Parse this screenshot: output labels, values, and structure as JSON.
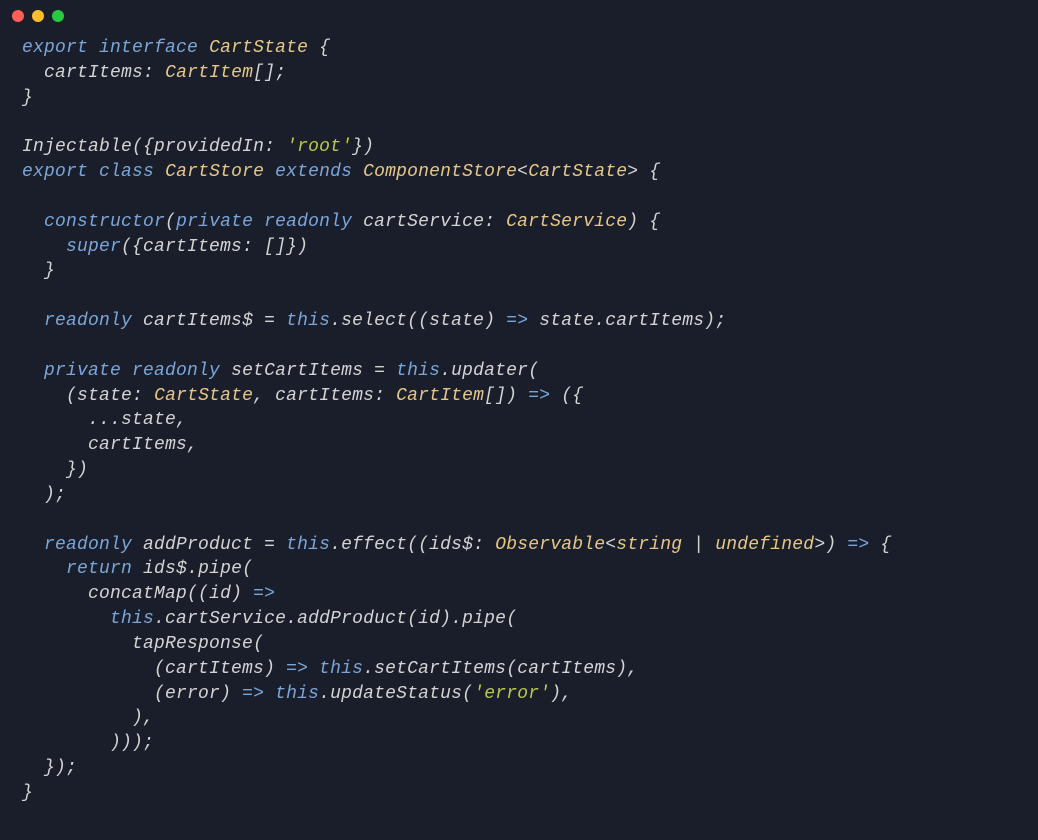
{
  "titleBar": {
    "buttons": [
      "close",
      "minimize",
      "maximize"
    ]
  },
  "code": {
    "tokens": [
      [
        {
          "t": "kw",
          "v": "export"
        },
        {
          "t": "sp",
          "v": " "
        },
        {
          "t": "kw",
          "v": "interface"
        },
        {
          "t": "sp",
          "v": " "
        },
        {
          "t": "type",
          "v": "CartState"
        },
        {
          "t": "sp",
          "v": " "
        },
        {
          "t": "punc",
          "v": "{"
        }
      ],
      [
        {
          "t": "sp",
          "v": "  "
        },
        {
          "t": "prop",
          "v": "cartItems"
        },
        {
          "t": "punc",
          "v": ": "
        },
        {
          "t": "type",
          "v": "CartItem"
        },
        {
          "t": "punc",
          "v": "[];"
        }
      ],
      [
        {
          "t": "punc",
          "v": "}"
        }
      ],
      [],
      [
        {
          "t": "decor",
          "v": "Injectable"
        },
        {
          "t": "punc",
          "v": "({"
        },
        {
          "t": "prop",
          "v": "providedIn"
        },
        {
          "t": "punc",
          "v": ": "
        },
        {
          "t": "str",
          "v": "'root'"
        },
        {
          "t": "punc",
          "v": "})"
        }
      ],
      [
        {
          "t": "kw",
          "v": "export"
        },
        {
          "t": "sp",
          "v": " "
        },
        {
          "t": "kw",
          "v": "class"
        },
        {
          "t": "sp",
          "v": " "
        },
        {
          "t": "type",
          "v": "CartStore"
        },
        {
          "t": "sp",
          "v": " "
        },
        {
          "t": "kw",
          "v": "extends"
        },
        {
          "t": "sp",
          "v": " "
        },
        {
          "t": "type",
          "v": "ComponentStore"
        },
        {
          "t": "punc",
          "v": "<"
        },
        {
          "t": "type",
          "v": "CartState"
        },
        {
          "t": "punc",
          "v": "> {"
        }
      ],
      [],
      [
        {
          "t": "sp",
          "v": "  "
        },
        {
          "t": "kw",
          "v": "constructor"
        },
        {
          "t": "punc",
          "v": "("
        },
        {
          "t": "kw",
          "v": "private"
        },
        {
          "t": "sp",
          "v": " "
        },
        {
          "t": "kw",
          "v": "readonly"
        },
        {
          "t": "sp",
          "v": " "
        },
        {
          "t": "param",
          "v": "cartService"
        },
        {
          "t": "punc",
          "v": ": "
        },
        {
          "t": "type",
          "v": "CartService"
        },
        {
          "t": "punc",
          "v": ") {"
        }
      ],
      [
        {
          "t": "sp",
          "v": "    "
        },
        {
          "t": "kw",
          "v": "super"
        },
        {
          "t": "punc",
          "v": "({"
        },
        {
          "t": "prop",
          "v": "cartItems"
        },
        {
          "t": "punc",
          "v": ": []})"
        }
      ],
      [
        {
          "t": "sp",
          "v": "  "
        },
        {
          "t": "punc",
          "v": "}"
        }
      ],
      [],
      [
        {
          "t": "sp",
          "v": "  "
        },
        {
          "t": "kw",
          "v": "readonly"
        },
        {
          "t": "sp",
          "v": " "
        },
        {
          "t": "prop",
          "v": "cartItems$"
        },
        {
          "t": "sp",
          "v": " "
        },
        {
          "t": "punc",
          "v": "= "
        },
        {
          "t": "this",
          "v": "this"
        },
        {
          "t": "punc",
          "v": "."
        },
        {
          "t": "method",
          "v": "select"
        },
        {
          "t": "punc",
          "v": "(("
        },
        {
          "t": "param",
          "v": "state"
        },
        {
          "t": "punc",
          "v": ") "
        },
        {
          "t": "kw",
          "v": "=>"
        },
        {
          "t": "sp",
          "v": " "
        },
        {
          "t": "var",
          "v": "state"
        },
        {
          "t": "punc",
          "v": "."
        },
        {
          "t": "prop",
          "v": "cartItems"
        },
        {
          "t": "punc",
          "v": ");"
        }
      ],
      [],
      [
        {
          "t": "sp",
          "v": "  "
        },
        {
          "t": "kw",
          "v": "private"
        },
        {
          "t": "sp",
          "v": " "
        },
        {
          "t": "kw",
          "v": "readonly"
        },
        {
          "t": "sp",
          "v": " "
        },
        {
          "t": "prop",
          "v": "setCartItems"
        },
        {
          "t": "sp",
          "v": " "
        },
        {
          "t": "punc",
          "v": "= "
        },
        {
          "t": "this",
          "v": "this"
        },
        {
          "t": "punc",
          "v": "."
        },
        {
          "t": "method",
          "v": "updater"
        },
        {
          "t": "punc",
          "v": "("
        }
      ],
      [
        {
          "t": "sp",
          "v": "    "
        },
        {
          "t": "punc",
          "v": "("
        },
        {
          "t": "param",
          "v": "state"
        },
        {
          "t": "punc",
          "v": ": "
        },
        {
          "t": "type",
          "v": "CartState"
        },
        {
          "t": "punc",
          "v": ", "
        },
        {
          "t": "param",
          "v": "cartItems"
        },
        {
          "t": "punc",
          "v": ": "
        },
        {
          "t": "type",
          "v": "CartItem"
        },
        {
          "t": "punc",
          "v": "[]) "
        },
        {
          "t": "kw",
          "v": "=>"
        },
        {
          "t": "sp",
          "v": " "
        },
        {
          "t": "punc",
          "v": "({"
        }
      ],
      [
        {
          "t": "sp",
          "v": "      "
        },
        {
          "t": "punc",
          "v": "..."
        },
        {
          "t": "var",
          "v": "state"
        },
        {
          "t": "punc",
          "v": ","
        }
      ],
      [
        {
          "t": "sp",
          "v": "      "
        },
        {
          "t": "var",
          "v": "cartItems"
        },
        {
          "t": "punc",
          "v": ","
        }
      ],
      [
        {
          "t": "sp",
          "v": "    "
        },
        {
          "t": "punc",
          "v": "})"
        }
      ],
      [
        {
          "t": "sp",
          "v": "  "
        },
        {
          "t": "punc",
          "v": ");"
        }
      ],
      [],
      [
        {
          "t": "sp",
          "v": "  "
        },
        {
          "t": "kw",
          "v": "readonly"
        },
        {
          "t": "sp",
          "v": " "
        },
        {
          "t": "prop",
          "v": "addProduct"
        },
        {
          "t": "sp",
          "v": " "
        },
        {
          "t": "punc",
          "v": "= "
        },
        {
          "t": "this",
          "v": "this"
        },
        {
          "t": "punc",
          "v": "."
        },
        {
          "t": "method",
          "v": "effect"
        },
        {
          "t": "punc",
          "v": "(("
        },
        {
          "t": "param",
          "v": "ids$"
        },
        {
          "t": "punc",
          "v": ": "
        },
        {
          "t": "type",
          "v": "Observable"
        },
        {
          "t": "punc",
          "v": "<"
        },
        {
          "t": "type",
          "v": "string"
        },
        {
          "t": "sp",
          "v": " "
        },
        {
          "t": "punc",
          "v": "| "
        },
        {
          "t": "type",
          "v": "undefined"
        },
        {
          "t": "punc",
          "v": ">) "
        },
        {
          "t": "kw",
          "v": "=>"
        },
        {
          "t": "sp",
          "v": " "
        },
        {
          "t": "punc",
          "v": "{"
        }
      ],
      [
        {
          "t": "sp",
          "v": "    "
        },
        {
          "t": "kw",
          "v": "return"
        },
        {
          "t": "sp",
          "v": " "
        },
        {
          "t": "var",
          "v": "ids$"
        },
        {
          "t": "punc",
          "v": "."
        },
        {
          "t": "method",
          "v": "pipe"
        },
        {
          "t": "punc",
          "v": "("
        }
      ],
      [
        {
          "t": "sp",
          "v": "      "
        },
        {
          "t": "method",
          "v": "concatMap"
        },
        {
          "t": "punc",
          "v": "(("
        },
        {
          "t": "param",
          "v": "id"
        },
        {
          "t": "punc",
          "v": ") "
        },
        {
          "t": "kw",
          "v": "=>"
        }
      ],
      [
        {
          "t": "sp",
          "v": "        "
        },
        {
          "t": "this",
          "v": "this"
        },
        {
          "t": "punc",
          "v": "."
        },
        {
          "t": "var",
          "v": "cartService"
        },
        {
          "t": "punc",
          "v": "."
        },
        {
          "t": "method",
          "v": "addProduct"
        },
        {
          "t": "punc",
          "v": "("
        },
        {
          "t": "var",
          "v": "id"
        },
        {
          "t": "punc",
          "v": ")."
        },
        {
          "t": "method",
          "v": "pipe"
        },
        {
          "t": "punc",
          "v": "("
        }
      ],
      [
        {
          "t": "sp",
          "v": "          "
        },
        {
          "t": "method",
          "v": "tapResponse"
        },
        {
          "t": "punc",
          "v": "("
        }
      ],
      [
        {
          "t": "sp",
          "v": "            "
        },
        {
          "t": "punc",
          "v": "("
        },
        {
          "t": "param",
          "v": "cartItems"
        },
        {
          "t": "punc",
          "v": ") "
        },
        {
          "t": "kw",
          "v": "=>"
        },
        {
          "t": "sp",
          "v": " "
        },
        {
          "t": "this",
          "v": "this"
        },
        {
          "t": "punc",
          "v": "."
        },
        {
          "t": "method",
          "v": "setCartItems"
        },
        {
          "t": "punc",
          "v": "("
        },
        {
          "t": "var",
          "v": "cartItems"
        },
        {
          "t": "punc",
          "v": "),"
        }
      ],
      [
        {
          "t": "sp",
          "v": "            "
        },
        {
          "t": "punc",
          "v": "("
        },
        {
          "t": "param",
          "v": "error"
        },
        {
          "t": "punc",
          "v": ") "
        },
        {
          "t": "kw",
          "v": "=>"
        },
        {
          "t": "sp",
          "v": " "
        },
        {
          "t": "this",
          "v": "this"
        },
        {
          "t": "punc",
          "v": "."
        },
        {
          "t": "method",
          "v": "updateStatus"
        },
        {
          "t": "punc",
          "v": "("
        },
        {
          "t": "str",
          "v": "'error'"
        },
        {
          "t": "punc",
          "v": "),"
        }
      ],
      [
        {
          "t": "sp",
          "v": "          "
        },
        {
          "t": "punc",
          "v": "),"
        }
      ],
      [
        {
          "t": "sp",
          "v": "        "
        },
        {
          "t": "punc",
          "v": ")));"
        }
      ],
      [
        {
          "t": "sp",
          "v": "  "
        },
        {
          "t": "punc",
          "v": "});"
        }
      ],
      [
        {
          "t": "punc",
          "v": "}"
        }
      ]
    ]
  }
}
